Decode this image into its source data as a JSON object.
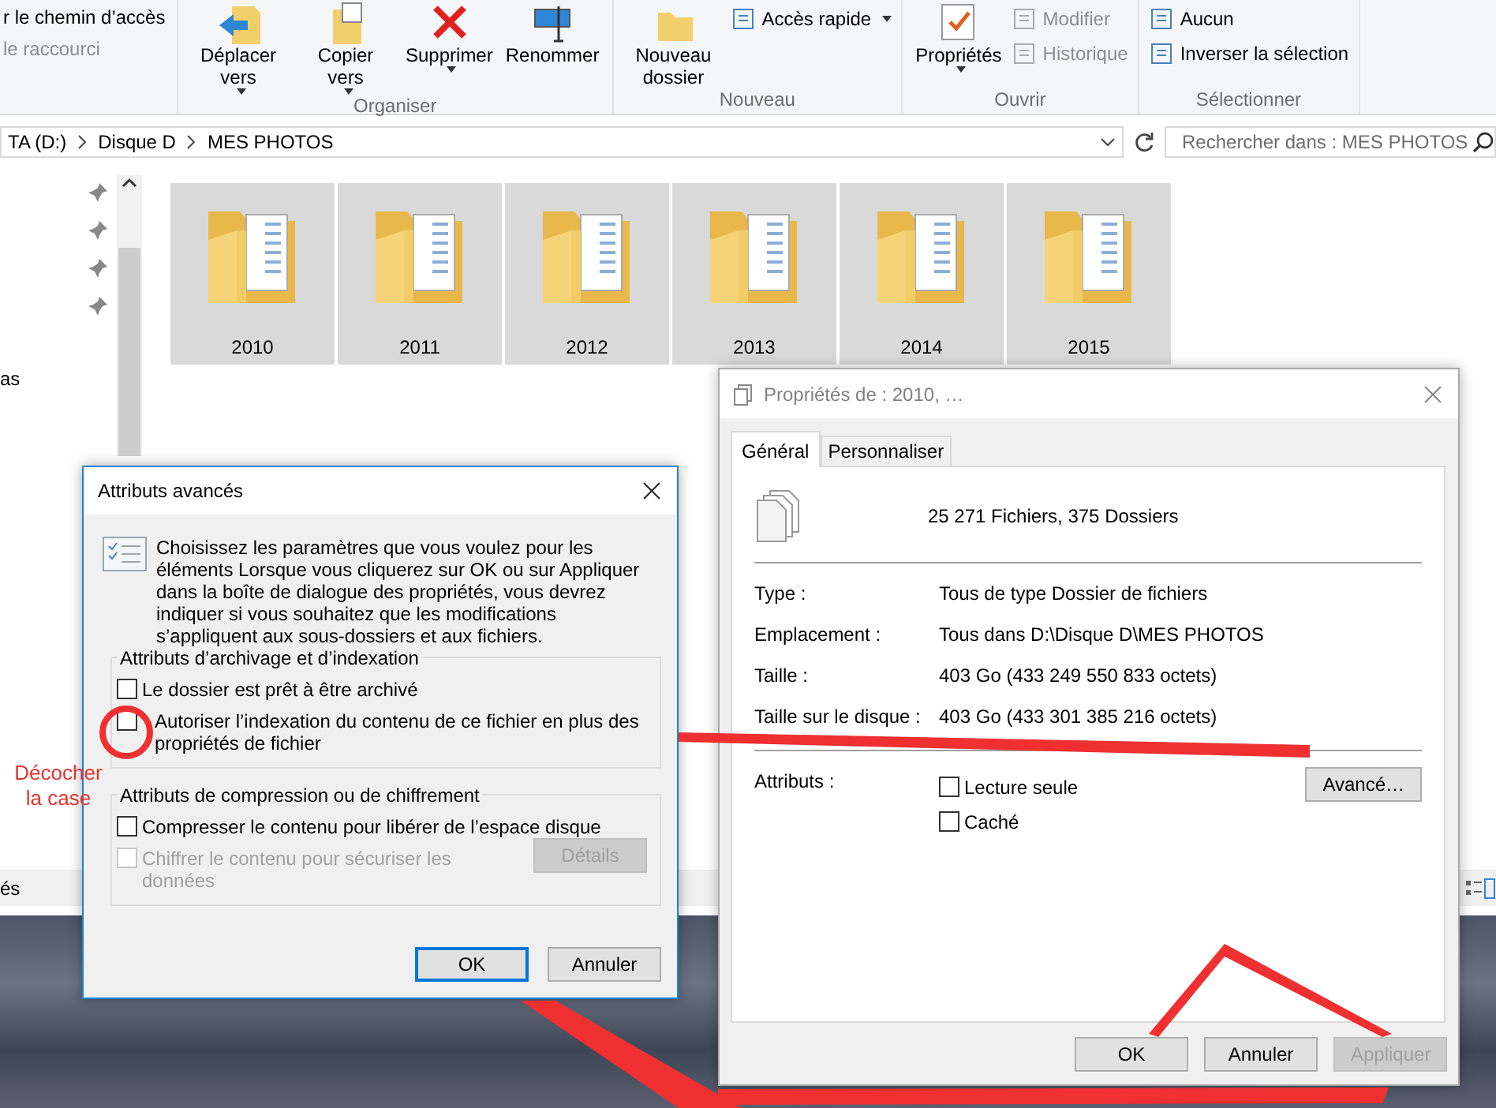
{
  "ribbon": {
    "groups": [
      {
        "items": [
          {
            "kind": "small",
            "label": "r le chemin d’accès",
            "disabled": false,
            "dropdown": false
          },
          {
            "kind": "small",
            "label": "le raccourci",
            "disabled": true,
            "dropdown": false
          }
        ]
      },
      {
        "label": "Organiser",
        "items": [
          {
            "kind": "large",
            "label": "Déplacer vers",
            "disabled": false,
            "dropdown": true
          },
          {
            "kind": "large",
            "label": "Copier vers",
            "disabled": false,
            "dropdown": true
          },
          {
            "kind": "large",
            "label": "Supprimer",
            "disabled": false,
            "dropdown": true
          },
          {
            "kind": "large",
            "label": "Renommer",
            "disabled": false,
            "dropdown": false
          }
        ]
      },
      {
        "label": "Nouveau",
        "items": [
          {
            "kind": "large",
            "label": "Nouveau dossier",
            "disabled": false,
            "dropdown": false
          },
          {
            "kind": "small",
            "label": "Accès rapide",
            "disabled": false,
            "dropdown": true
          }
        ]
      },
      {
        "label": "Ouvrir",
        "items": [
          {
            "kind": "large",
            "label": "Propriétés",
            "disabled": false,
            "dropdown": true
          },
          {
            "kind": "small",
            "label": "Modifier",
            "disabled": true,
            "dropdown": false
          },
          {
            "kind": "small",
            "label": "Historique",
            "disabled": true,
            "dropdown": false
          }
        ]
      },
      {
        "label": "Sélectionner",
        "items": [
          {
            "kind": "small",
            "label": "Aucun",
            "disabled": false,
            "dropdown": false
          },
          {
            "kind": "small",
            "label": "Inverser la sélection",
            "disabled": false,
            "dropdown": false
          }
        ]
      }
    ]
  },
  "address_bar": {
    "breadcrumbs": [
      "TA (D:)",
      "Disque D",
      "MES PHOTOS"
    ],
    "search": {
      "placeholder": "Rechercher dans : MES PHOTOS"
    }
  },
  "navigation_pane": {
    "items": [
      "as"
    ]
  },
  "folders": [
    {
      "name": "2010",
      "selected": true
    },
    {
      "name": "2011",
      "selected": true
    },
    {
      "name": "2012",
      "selected": true
    },
    {
      "name": "2013",
      "selected": true
    },
    {
      "name": "2014",
      "selected": true
    },
    {
      "name": "2015",
      "selected": true
    }
  ],
  "status_bar": {
    "text": "és"
  },
  "properties_dialog": {
    "title": "Propriétés de : 2010, …",
    "tabs": [
      {
        "label": "Général",
        "selected": true
      },
      {
        "label": "Personnaliser",
        "selected": false
      }
    ],
    "summary": "25 271 Fichiers, 375 Dossiers",
    "rows": [
      {
        "label": "Type :",
        "value": "Tous de type Dossier de fichiers"
      },
      {
        "label": "Emplacement :",
        "value": "Tous dans D:\\Disque D\\MES PHOTOS"
      },
      {
        "label": "Taille :",
        "value": "403 Go (433 249 550 833 octets)"
      },
      {
        "label": "Taille sur le disque :",
        "value": "403 Go (433 301 385 216 octets)"
      }
    ],
    "attributes_label": "Attributs :",
    "attributes": [
      {
        "label": "Lecture seule",
        "checked": false
      },
      {
        "label": "Caché",
        "checked": false
      }
    ],
    "advanced_button": "Avancé…",
    "buttons": [
      {
        "label": "OK",
        "disabled": false
      },
      {
        "label": "Annuler",
        "disabled": false
      },
      {
        "label": "Appliquer",
        "disabled": true
      }
    ]
  },
  "advanced_dialog": {
    "title": "Attributs avancés",
    "intro": "Choisissez les paramètres que vous voulez pour les éléments Lorsque vous cliquerez sur OK ou sur Appliquer dans la boîte de dialogue des propriétés, vous devrez indiquer si vous souhaitez que les modifications s’appliquent aux sous-dossiers et aux fichiers.",
    "groups": [
      {
        "title": "Attributs d’archivage et d’indexation",
        "options": [
          {
            "label": "Le dossier est prêt à être archivé",
            "checked": false,
            "disabled": false
          },
          {
            "label": "Autoriser l’indexation du contenu de ce fichier en plus des propriétés de fichier",
            "checked": false,
            "disabled": false
          }
        ]
      },
      {
        "title": "Attributs de compression ou de chiffrement",
        "options": [
          {
            "label": "Compresser le contenu pour libérer de l’espace disque",
            "checked": false,
            "disabled": false
          },
          {
            "label": "Chiffrer le contenu pour sécuriser les données",
            "checked": false,
            "disabled": true
          }
        ],
        "button": {
          "label": "Détails",
          "disabled": true
        }
      }
    ],
    "buttons": [
      {
        "label": "OK",
        "default": true
      },
      {
        "label": "Annuler",
        "default": false
      }
    ]
  },
  "annotation": {
    "text": "Décocher la case"
  }
}
